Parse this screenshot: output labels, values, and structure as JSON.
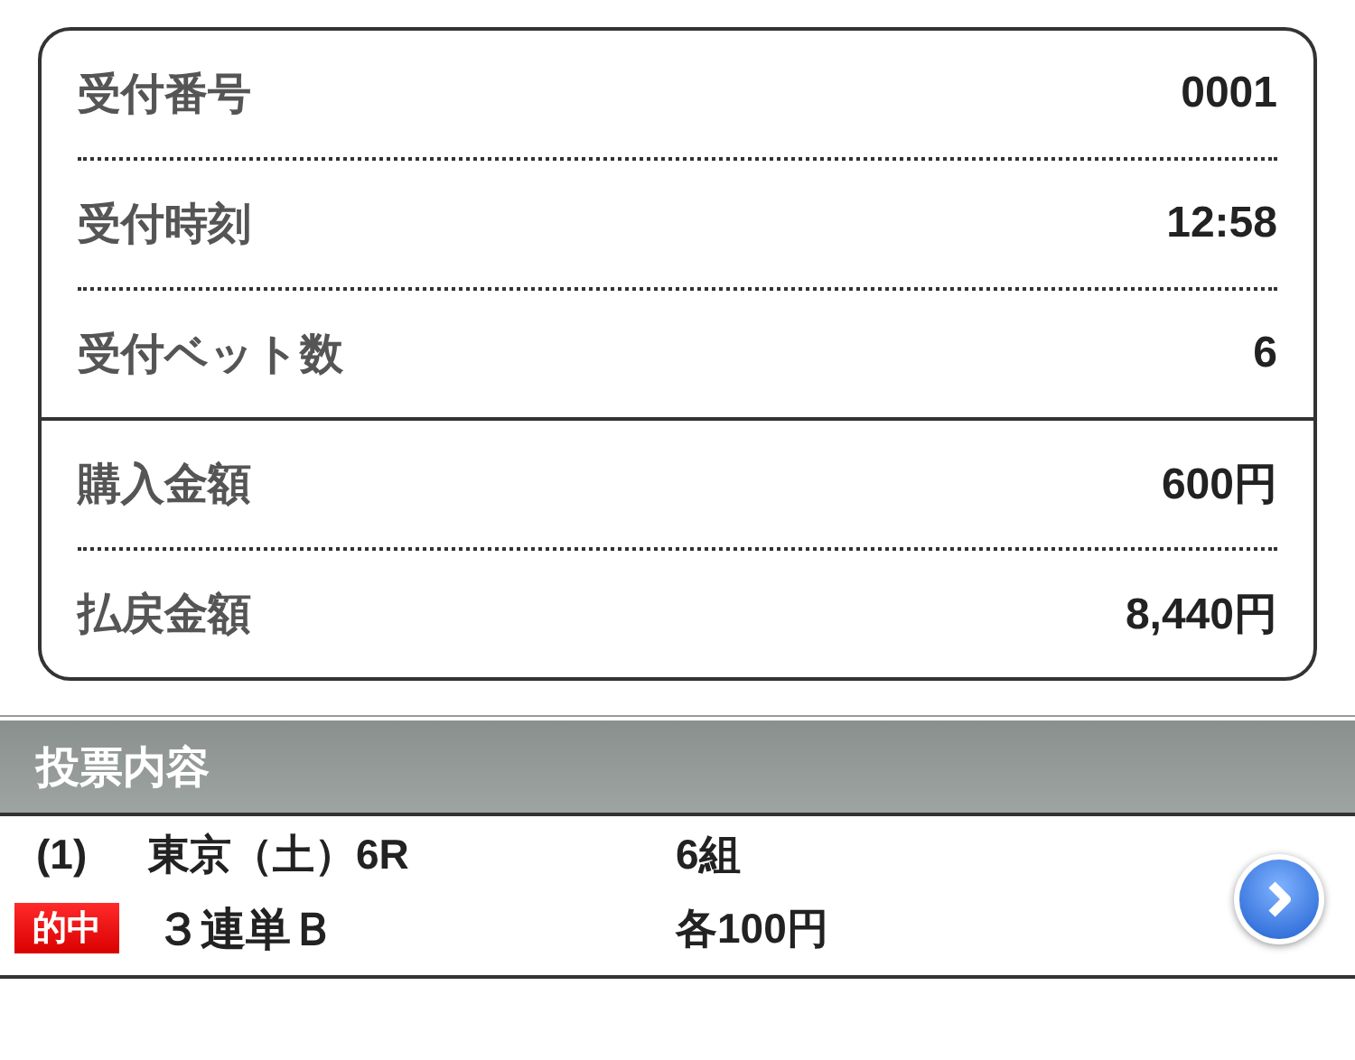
{
  "summary": {
    "groups": [
      {
        "rows": [
          {
            "label": "受付番号",
            "value": "0001"
          },
          {
            "label": "受付時刻",
            "value": "12:58"
          },
          {
            "label": "受付ベット数",
            "value": "6"
          }
        ]
      },
      {
        "rows": [
          {
            "label": "購入金額",
            "value": "600円"
          },
          {
            "label": "払戻金額",
            "value": "8,440円"
          }
        ]
      }
    ]
  },
  "section": {
    "title": "投票内容"
  },
  "bets": [
    {
      "number": "(1)",
      "race": "東京（土）6R",
      "combos": "6組",
      "badge": "的中",
      "bet_type": "３連単Ｂ",
      "amount": "各100円"
    }
  ]
}
